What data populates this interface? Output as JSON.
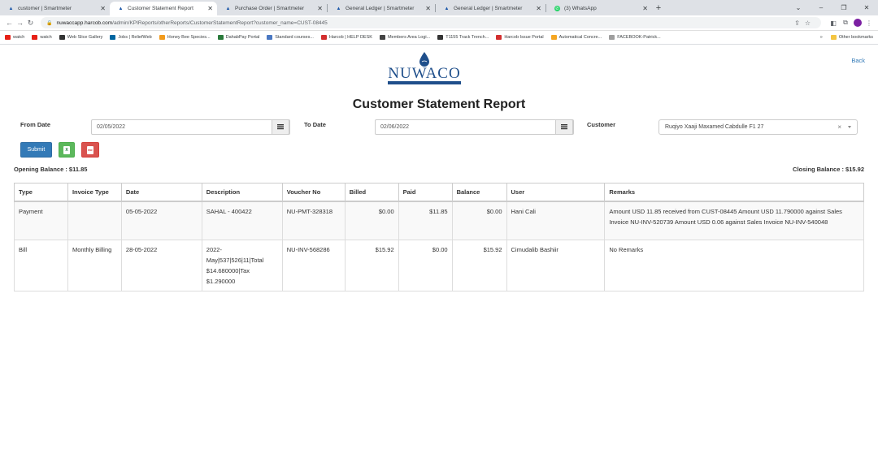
{
  "browser": {
    "tabs": [
      {
        "title": "customer | Smartmeter",
        "active": false,
        "icon": "drop-icon"
      },
      {
        "title": "Customer Statement Report",
        "active": true,
        "icon": "drop-icon"
      },
      {
        "title": "Purchase Order | Smartmeter",
        "active": false,
        "icon": "drop-icon"
      },
      {
        "title": "General Ledger | Smartmeter",
        "active": false,
        "icon": "drop-icon"
      },
      {
        "title": "General Ledger | Smartmeter",
        "active": false,
        "icon": "drop-icon"
      },
      {
        "title": "(3) WhatsApp",
        "active": false,
        "icon": "whatsapp-icon"
      }
    ],
    "url_host": "nuwaccapp.harcob.com",
    "url_path": "/admin/KPIReports/otherReports/CustomerStatementReport?customer_name=CUST-08445",
    "bookmarks": [
      {
        "label": "watch",
        "color": "#e62117"
      },
      {
        "label": "watch",
        "color": "#e62117"
      },
      {
        "label": "Web Slice Gallery",
        "color": "#333333"
      },
      {
        "label": "Jobs | ReliefWeb",
        "color": "#0066a1"
      },
      {
        "label": "Honey Bee Species...",
        "color": "#f29b1d"
      },
      {
        "label": "DahabPay Portal",
        "color": "#2a7a3b"
      },
      {
        "label": "Standard courses...",
        "color": "#4a78c2"
      },
      {
        "label": "Harcob | HELP DESK",
        "color": "#d32f2f"
      },
      {
        "label": "Members Area Logi...",
        "color": "#444444"
      },
      {
        "label": "T1155 Track Trench...",
        "color": "#333333"
      },
      {
        "label": "Harcob Issue Portal",
        "color": "#d32f2f"
      },
      {
        "label": "Automatical Concre...",
        "color": "#f5a623"
      },
      {
        "label": "FACEBOOK-Patrick...",
        "color": "#9e9e9e"
      }
    ],
    "more_label": "»",
    "other_bookmarks": "Other bookmarks"
  },
  "page": {
    "back_label": "Back",
    "logo_text": "NUWACO",
    "title": "Customer Statement Report",
    "filters": {
      "from_label": "From Date",
      "from_value": "02/05/2022",
      "to_label": "To Date",
      "to_value": "02/06/2022",
      "customer_label": "Customer",
      "customer_value": "Ruqiyo Xaaji Maxamed Cabdulle F1 27"
    },
    "actions": {
      "submit_label": "Submit",
      "excel_label": "X",
      "pdf_label": "PDF"
    },
    "opening_balance": "Opening Balance : $11.85",
    "closing_balance": "Closing Balance : $15.92"
  },
  "table": {
    "headers": [
      "Type",
      "Invoice Type",
      "Date",
      "Description",
      "Voucher No",
      "Billed",
      "Paid",
      "Balance",
      "User",
      "Remarks"
    ],
    "rows": [
      {
        "type": "Payment",
        "invoice_type": "",
        "date": "05-05-2022",
        "description": "SAHAL - 400422",
        "voucher": "NU-PMT-328318",
        "billed": "$0.00",
        "paid": "$11.85",
        "balance": "$0.00",
        "user": "Hani Cali",
        "remarks": "Amount USD 11.85 received from CUST-08445 Amount USD 11.790000 against Sales Invoice NU-INV-520739 Amount USD 0.06 against Sales Invoice NU-INV-540048"
      },
      {
        "type": "Bill",
        "invoice_type": "Monthly Billing",
        "date": "28-05-2022",
        "description": "2022-May|537|526|11|Total $14.680000|Tax $1.290000",
        "voucher": "NU-INV-568286",
        "billed": "$15.92",
        "paid": "$0.00",
        "balance": "$15.92",
        "user": "Cimudalib Bashiir",
        "remarks": "No Remarks"
      }
    ]
  }
}
